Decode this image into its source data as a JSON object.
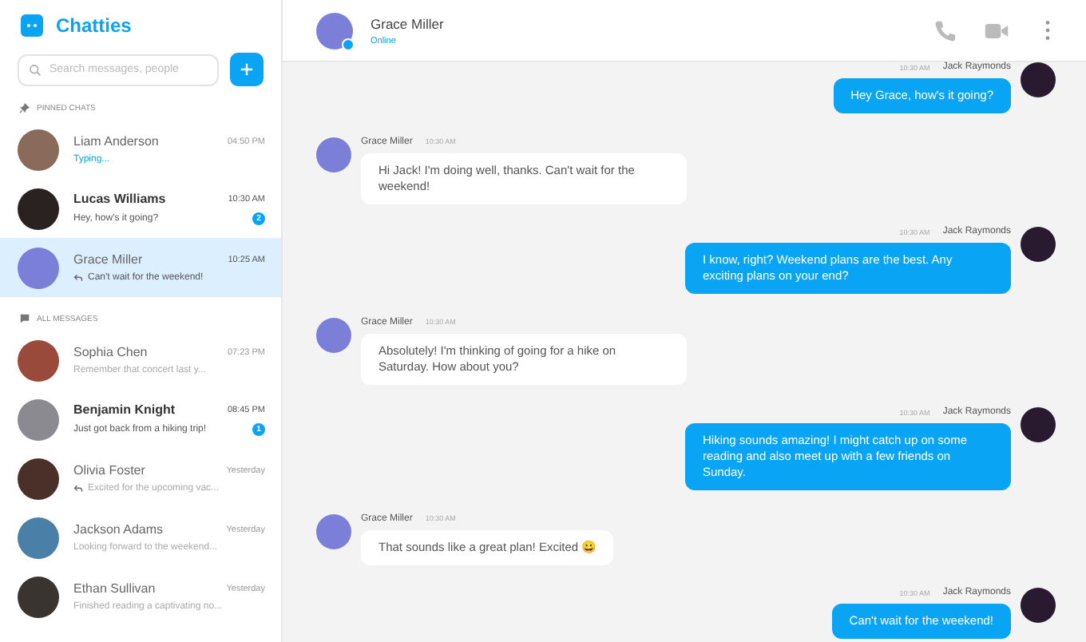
{
  "app": {
    "title": "Chatties"
  },
  "search": {
    "placeholder": "Search messages, people"
  },
  "pinned": {
    "label": "PINNED CHATS",
    "chats": [
      {
        "name": "Liam Anderson",
        "time": "04:50 PM",
        "preview": "Typing...",
        "typing": true,
        "replied": false,
        "selected": false,
        "color": "#8a6a5a"
      },
      {
        "name": "Lucas Williams",
        "time": "10:30 AM",
        "preview": "Hey, how's it going?",
        "typing": false,
        "unread": "2",
        "replied": false,
        "selected": false,
        "color": "#2a2220"
      },
      {
        "name": "Grace Miller",
        "time": "10:25 AM",
        "preview": "Can't wait for the weekend!",
        "typing": false,
        "replied": true,
        "selected": true,
        "color": "#7b7fd8"
      }
    ]
  },
  "all": {
    "label": "ALL MESSAGES",
    "chats": [
      {
        "name": "Sophia Chen",
        "time": "07:23 PM",
        "preview": "Remember that concert last y...",
        "typing": false,
        "replied": false,
        "selected": false,
        "color": "#9a4a3a"
      },
      {
        "name": "Benjamin Knight",
        "time": "08:45 PM",
        "preview": "Just got back from a hiking trip!",
        "typing": false,
        "unread": "1",
        "replied": false,
        "selected": false,
        "color": "#8a8a90"
      },
      {
        "name": "Olivia Foster",
        "time": "Yesterday",
        "preview": "Excited for the upcoming vac...",
        "typing": false,
        "replied": true,
        "selected": false,
        "color": "#4a3028"
      },
      {
        "name": "Jackson Adams",
        "time": "Yesterday",
        "preview": "Looking forward to the weekend...",
        "typing": false,
        "replied": false,
        "selected": false,
        "color": "#4a7fa8"
      },
      {
        "name": "Ethan Sullivan",
        "time": "Yesterday",
        "preview": "Finished reading a captivating no...",
        "typing": false,
        "replied": false,
        "selected": false,
        "color": "#3a3430"
      }
    ]
  },
  "contact": {
    "name": "Grace Miller",
    "status": "Online"
  },
  "messages": [
    {
      "kind": "out",
      "sender": "Jack Raymonds",
      "time": "10:30 AM",
      "text": "Hey Grace, how's it going?"
    },
    {
      "kind": "in",
      "sender": "Grace Miller",
      "time": "10:30 AM",
      "text": "Hi Jack! I'm doing well, thanks. Can't wait for the weekend!"
    },
    {
      "kind": "out",
      "sender": "Jack Raymonds",
      "time": "10:30 AM",
      "text": "I know, right? Weekend plans are the best. Any exciting plans on your end?"
    },
    {
      "kind": "in",
      "sender": "Grace Miller",
      "time": "10:30 AM",
      "text": "Absolutely! I'm thinking of going for a hike on Saturday. How about you?"
    },
    {
      "kind": "out",
      "sender": "Jack Raymonds",
      "time": "10:30 AM",
      "text": "Hiking sounds amazing! I might catch up on some reading and also meet up with a few friends on Sunday."
    },
    {
      "kind": "in",
      "sender": "Grace Miller",
      "time": "10:30 AM",
      "text": "That sounds like a great plan! Excited 😀"
    },
    {
      "kind": "out",
      "sender": "Jack Raymonds",
      "time": "10:30 AM",
      "text": "Can't wait for the weekend!"
    }
  ]
}
